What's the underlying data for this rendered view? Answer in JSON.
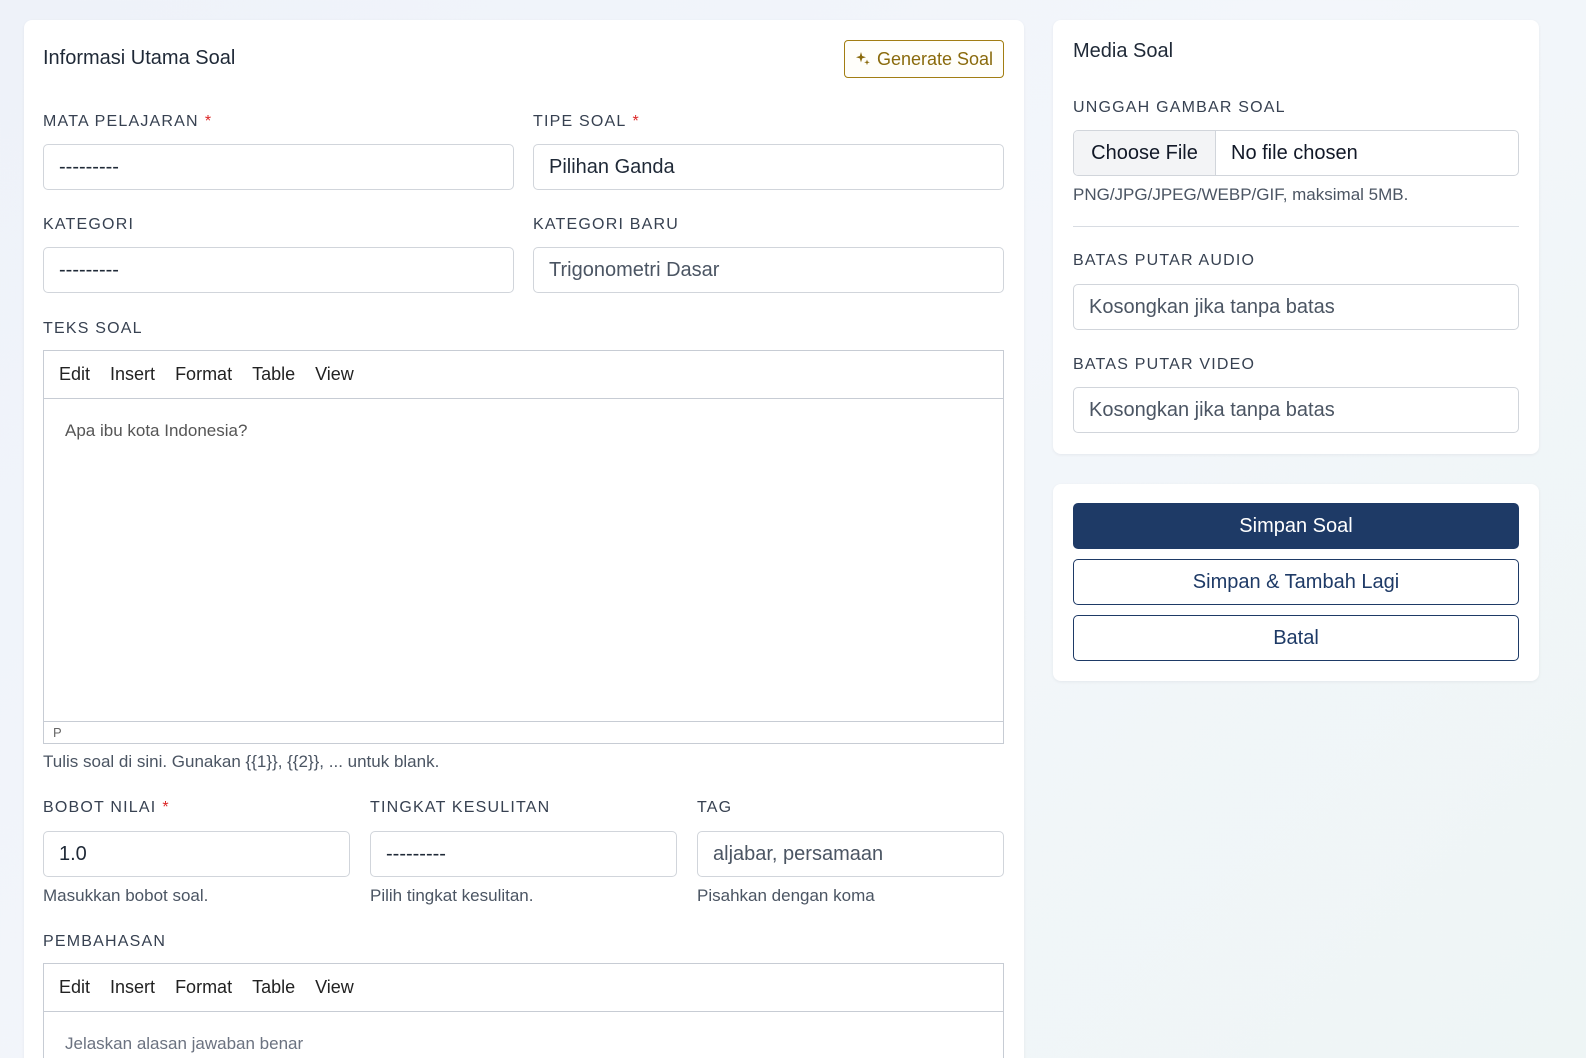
{
  "main": {
    "title": "Informasi Utama Soal",
    "generate_button": "Generate Soal",
    "mata_pelajaran": {
      "label": "MATA PELAJARAN",
      "required": "*",
      "value": "---------"
    },
    "tipe_soal": {
      "label": "TIPE SOAL",
      "required": "*",
      "value": "Pilihan Ganda"
    },
    "kategori": {
      "label": "KATEGORI",
      "value": "---------"
    },
    "kategori_baru": {
      "label": "KATEGORI BARU",
      "placeholder": "Trigonometri Dasar"
    },
    "teks_soal": {
      "label": "TEKS SOAL",
      "menu": [
        "Edit",
        "Insert",
        "Format",
        "Table",
        "View"
      ],
      "content": "Apa ibu kota Indonesia?",
      "status_path": "P",
      "help": "Tulis soal di sini. Gunakan {{1}}, {{2}}, ... untuk blank."
    },
    "bobot_nilai": {
      "label": "BOBOT NILAI",
      "required": "*",
      "value": "1.0",
      "help": "Masukkan bobot soal."
    },
    "tingkat_kesulitan": {
      "label": "TINGKAT KESULITAN",
      "value": "---------",
      "help": "Pilih tingkat kesulitan."
    },
    "tag": {
      "label": "TAG",
      "placeholder": "aljabar, persamaan",
      "help": "Pisahkan dengan koma"
    },
    "pembahasan": {
      "label": "PEMBAHASAN",
      "menu": [
        "Edit",
        "Insert",
        "Format",
        "Table",
        "View"
      ],
      "placeholder": "Jelaskan alasan jawaban benar"
    }
  },
  "media": {
    "title": "Media Soal",
    "gambar": {
      "label": "UNGGAH GAMBAR SOAL",
      "button": "Choose File",
      "status": "No file chosen",
      "help": "PNG/JPG/JPEG/WEBP/GIF, maksimal 5MB."
    },
    "audio": {
      "label": "BATAS PUTAR AUDIO",
      "placeholder": "Kosongkan jika tanpa batas"
    },
    "video": {
      "label": "BATAS PUTAR VIDEO",
      "placeholder": "Kosongkan jika tanpa batas"
    }
  },
  "actions": {
    "save": "Simpan Soal",
    "save_add": "Simpan & Tambah Lagi",
    "cancel": "Batal"
  },
  "colors": {
    "primary": "#1e3a66",
    "generate_accent": "#a27d12",
    "required": "#dc2626"
  }
}
